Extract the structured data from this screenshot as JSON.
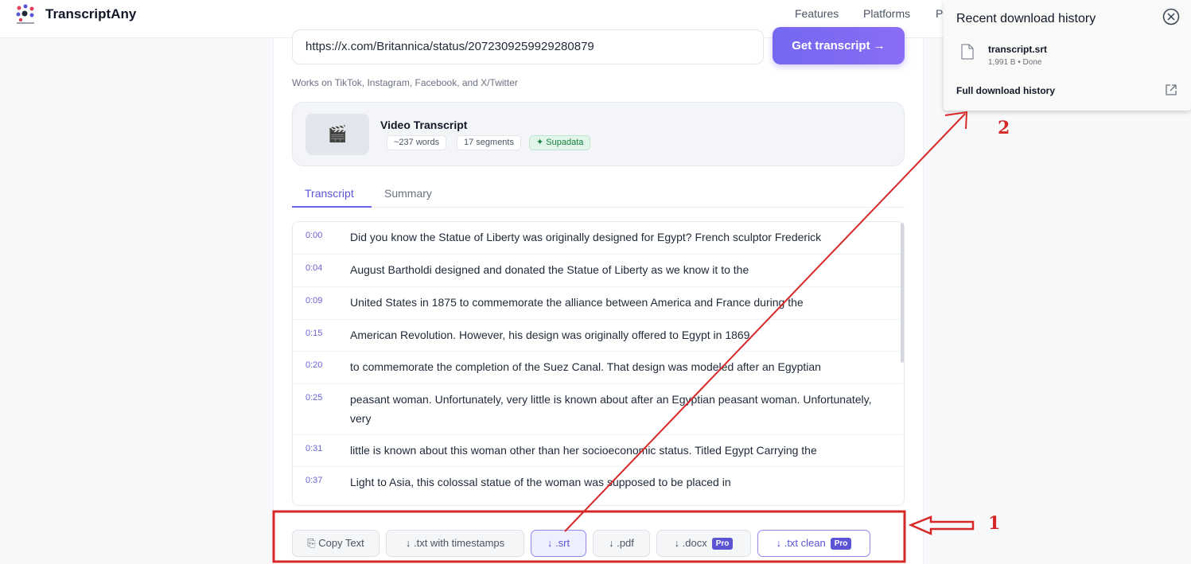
{
  "app": {
    "name": "TranscriptAny"
  },
  "nav": {
    "features": "Features",
    "platforms": "Platforms",
    "partial": "P"
  },
  "search": {
    "url_value": "https://x.com/Britannica/status/2072309259929280879",
    "button_label": "Get transcript →"
  },
  "works_on": "Works on TikTok, Instagram, Facebook, and X/Twitter",
  "video": {
    "thumb_icon": "clapper-icon",
    "title": "Video Transcript",
    "words": "~237 words",
    "segments": "17 segments",
    "source": "✦ Supadata"
  },
  "tabs": {
    "transcript": "Transcript",
    "summary": "Summary"
  },
  "transcript": [
    {
      "time": "0:00",
      "text": "Did you know the Statue of Liberty was originally designed for Egypt? French sculptor Frederick"
    },
    {
      "time": "0:04",
      "text": "August Bartholdi designed and donated the Statue of Liberty as we know it to the"
    },
    {
      "time": "0:09",
      "text": "United States in 1875 to commemorate the alliance between America and France during the"
    },
    {
      "time": "0:15",
      "text": "American Revolution. However, his design was originally offered to Egypt in 1869"
    },
    {
      "time": "0:20",
      "text": "to commemorate the completion of the Suez Canal. That design was modeled after an Egyptian"
    },
    {
      "time": "0:25",
      "text": "peasant woman. Unfortunately, very little is known about after an Egyptian peasant woman. Unfortunately, very"
    },
    {
      "time": "0:31",
      "text": "little is known about this woman other than her socioeconomic status. Titled Egypt Carrying the"
    },
    {
      "time": "0:37",
      "text": "Light to Asia, this colossal statue of the woman was supposed to be placed in"
    }
  ],
  "actions": {
    "copy": "⎘ Copy Text",
    "txt_ts": "↓ .txt with timestamps",
    "srt": "↓ .srt",
    "pdf": "↓ .pdf",
    "docx": "↓ .docx",
    "txt_clean": "↓ .txt clean",
    "pro": "Pro"
  },
  "downloads": {
    "title": "Recent download history",
    "file_name": "transcript.srt",
    "file_meta": "1,991 B • Done",
    "full_history": "Full download history"
  },
  "annotations": {
    "one": "1",
    "two": "2",
    "color": "#d62828"
  }
}
